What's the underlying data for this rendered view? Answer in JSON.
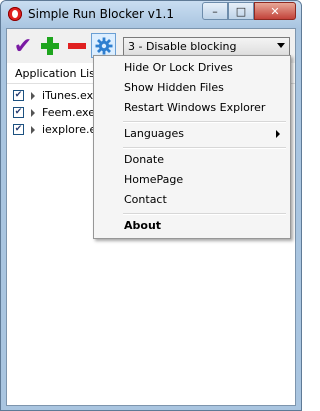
{
  "window": {
    "title": "Simple Run Blocker v1.1"
  },
  "caption_buttons": {
    "minimize": "–",
    "maximize": "□",
    "close": "✕"
  },
  "toolbar": {
    "mode_select_value": "3 - Disable blocking",
    "colors": {
      "check": "#7a1aa3",
      "plus": "#1ea51e",
      "minus": "#e02020",
      "gear": "#2f7fd0"
    }
  },
  "list": {
    "header": "Application List",
    "items": [
      {
        "name": "iTunes.exe",
        "checked": true
      },
      {
        "name": "Feem.exe",
        "checked": true
      },
      {
        "name": "iexplore.exe",
        "checked": true
      }
    ]
  },
  "menu": {
    "items": [
      {
        "label": "Hide Or Lock Drives"
      },
      {
        "label": "Show Hidden Files"
      },
      {
        "label": "Restart Windows Explorer"
      },
      {
        "label": "Languages"
      },
      {
        "label": "Donate"
      },
      {
        "label": "HomePage"
      },
      {
        "label": "Contact"
      },
      {
        "label": "About"
      }
    ]
  }
}
